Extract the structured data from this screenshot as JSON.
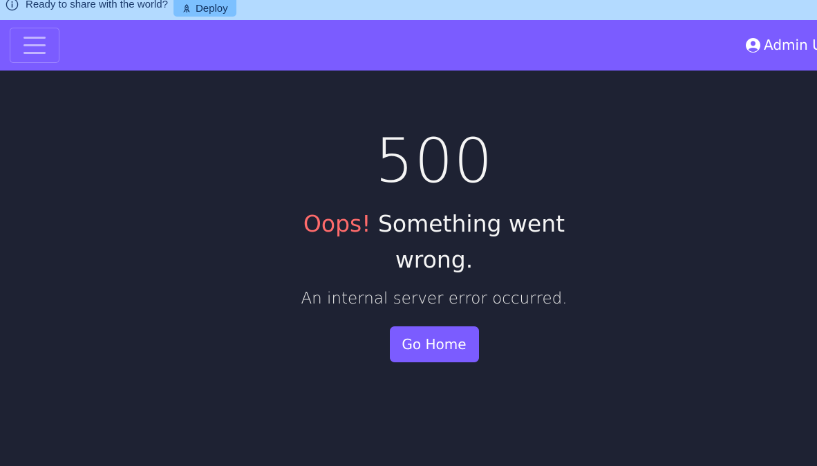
{
  "banner": {
    "message": "Ready to share with the world?",
    "deploy_label": "Deploy",
    "info_icon": "info-circle-icon",
    "deploy_icon": "rocket-icon"
  },
  "navbar": {
    "toggler_icon": "hamburger-icon",
    "user_icon": "user-circle-icon",
    "user_label": "Admin U",
    "color": "#7b5cff"
  },
  "error": {
    "code": "500",
    "oops": "Oops!",
    "headline": "Something went wrong.",
    "message": "An internal server error occurred.",
    "button_label": "Go Home",
    "oops_color": "#ff6b6b"
  }
}
